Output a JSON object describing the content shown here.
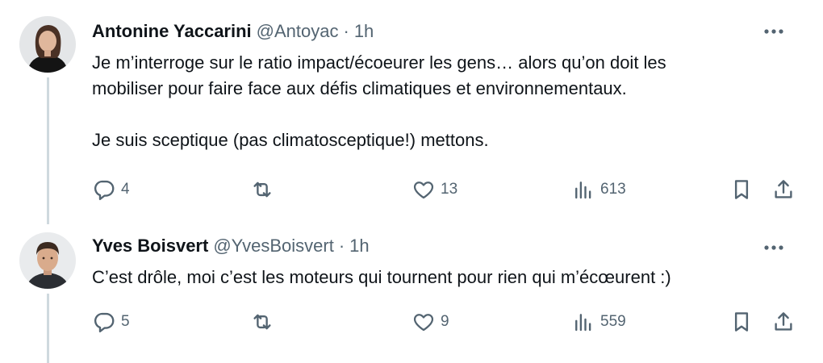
{
  "tweets": [
    {
      "author": {
        "name": "Antonine Yaccarini",
        "handle": "@Antoyac"
      },
      "separator": "·",
      "time": "1h",
      "paragraphs": [
        "Je m’interroge sur le ratio impact/écoeurer les gens… alors qu’on doit les",
        "mobiliser pour faire face aux défis climatiques et environnementaux.",
        "Je suis sceptique (pas climatosceptique!) mettons."
      ],
      "stats": {
        "replies": "4",
        "likes": "13",
        "views": "613"
      }
    },
    {
      "author": {
        "name": "Yves Boisvert",
        "handle": "@YvesBoisvert"
      },
      "separator": "·",
      "time": "1h",
      "paragraphs": [
        "C’est drôle, moi c’est les moteurs qui tournent pour rien qui m’écœurent :)"
      ],
      "stats": {
        "replies": "5",
        "likes": "9",
        "views": "559"
      }
    }
  ],
  "icons": {
    "reply": "speech-bubble",
    "repost": "retweet-arrows",
    "like": "heart",
    "views": "bar-chart",
    "bookmark": "bookmark",
    "share": "upload-arrow",
    "more": "three-dots"
  },
  "colors": {
    "text": "#0f1419",
    "secondary": "#536471",
    "thread_line": "#cfd9de",
    "background": "#ffffff"
  }
}
